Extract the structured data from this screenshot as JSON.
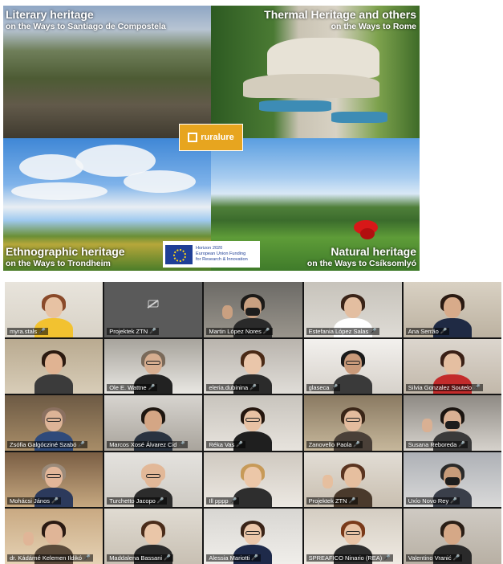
{
  "banner": {
    "top_left": {
      "title": "Literary heritage",
      "subtitle": "on the Ways to Santiago de Compostela"
    },
    "top_right": {
      "title": "Thermal Heritage and others",
      "subtitle": "on the Ways to Rome"
    },
    "bottom_left": {
      "title": "Ethnographic heritage",
      "subtitle": "on the Ways to Trondheim"
    },
    "bottom_right": {
      "title": "Natural heritage",
      "subtitle": "on the Ways to Csíksomlyó"
    },
    "logo_text": "ruralure",
    "funding": [
      "Horizon 2020",
      "European Union Funding",
      "for Research & Innovation"
    ]
  },
  "participants": [
    {
      "name": "myra.stals",
      "video": true
    },
    {
      "name": "Projektek ZTN",
      "video": false
    },
    {
      "name": "Martin López Nores",
      "video": true
    },
    {
      "name": "Estefania López Salas",
      "video": true
    },
    {
      "name": "Ana Serrão",
      "video": true
    },
    {
      "name": "",
      "video": true
    },
    {
      "name": "Ole E. Wattne",
      "video": true
    },
    {
      "name": "eleria.dubinina",
      "video": true
    },
    {
      "name": "glaseca",
      "video": true
    },
    {
      "name": "Silvia Gonzalez Soutelo",
      "video": true
    },
    {
      "name": "Zsófia Galgócziné Szabó",
      "video": true
    },
    {
      "name": "Marcos Xosé Álvarez Cid",
      "video": true
    },
    {
      "name": "Réka Vas",
      "video": true
    },
    {
      "name": "Zanovello Paola",
      "video": true
    },
    {
      "name": "Susana Reboreda",
      "video": true
    },
    {
      "name": "Mohácsi János",
      "video": true
    },
    {
      "name": "Turchetto Jacopo",
      "video": true
    },
    {
      "name": "Ill pppp",
      "video": true
    },
    {
      "name": "Projektek ZTN",
      "video": true
    },
    {
      "name": "Uxío Novo Rey",
      "video": true
    },
    {
      "name": "dr. Kádárné Kelemen Ildikó",
      "video": true
    },
    {
      "name": "Maddalena Bassani",
      "video": true
    },
    {
      "name": "Alessia Mariotti",
      "video": true
    },
    {
      "name": "SPREAFICO Ninario (REA)",
      "video": true
    },
    {
      "name": "Valentino Vranić",
      "video": true
    }
  ],
  "colors": {
    "logo_bg": "#e7a51f",
    "eu_blue": "#1f3f96",
    "grid_bg": "#151515"
  }
}
